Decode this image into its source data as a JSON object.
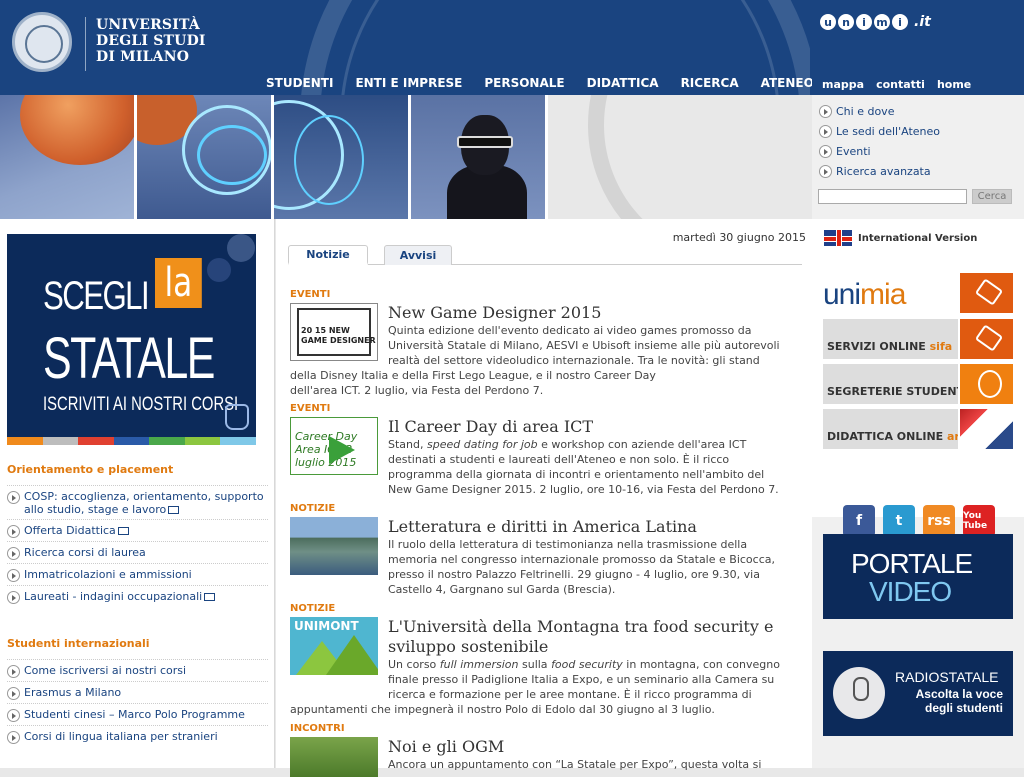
{
  "header": {
    "logo_lines": [
      "UNIVERSITÀ",
      "DEGLI STUDI",
      "DI MILANO"
    ],
    "unimi_letters": [
      "u",
      "n",
      "i",
      "m",
      "i"
    ],
    "unimi_suffix": ".it",
    "nav": [
      "STUDENTI",
      "ENTI E IMPRESE",
      "PERSONALE",
      "DIDATTICA",
      "RICERCA",
      "ATENEO"
    ],
    "util_nav": [
      "mappa",
      "contatti",
      "home"
    ]
  },
  "quick_links": [
    "Chi e dove",
    "Le sedi dell'Ateneo",
    "Eventi",
    "Ricerca avanzata"
  ],
  "search": {
    "value": "",
    "button": "Cerca"
  },
  "promo": {
    "line1": "SCEGLI",
    "la": "la",
    "line2": "STATALE",
    "line3": "ISCRIVITI AI NOSTRI CORSI"
  },
  "color_strip": [
    "#f08a1c",
    "#bdbdbd",
    "#e04030",
    "#2a5aa8",
    "#4aa84a",
    "#8cc63f",
    "#7fc8e8"
  ],
  "left": {
    "section1_title": "Orientamento e placement",
    "section1_items": [
      {
        "label": "COSP: accoglienza, orientamento, supporto allo studio, stage e lavoro",
        "external": true
      },
      {
        "label": "Offerta Didattica",
        "external": true
      },
      {
        "label": "Ricerca corsi di laurea",
        "external": false
      },
      {
        "label": "Immatricolazioni e ammissioni",
        "external": false
      },
      {
        "label": "Laureati - indagini occupazionali",
        "external": true
      }
    ],
    "section2_title": "Studenti internazionali",
    "section2_items": [
      {
        "label": "Come iscriversi ai nostri corsi"
      },
      {
        "label": "Erasmus a Milano"
      },
      {
        "label": "Studenti cinesi – Marco Polo Programme"
      },
      {
        "label": "Corsi di lingua italiana per stranieri"
      }
    ]
  },
  "main": {
    "date": "martedì 30 giugno 2015",
    "tabs": [
      "Notizie",
      "Avvisi"
    ],
    "news": [
      {
        "category": "EVENTI",
        "title": "New Game Designer 2015",
        "thumb_label": "20 15 NEW GAME DESIGNER",
        "description_lines": [
          "Quinta edizione dell'evento dedicato ai video games promosso da",
          "Università Statale di Milano, AESVI e Ubisoft insieme alle più autorevoli",
          "realtà del settore videoludico internazionale. Tra le novità: gli stand",
          "della Disney Italia e della First Lego League, e il nostro Career Day",
          "dell'area ICT. 2 luglio, via Festa del Perdono 7."
        ]
      },
      {
        "category": "EVENTI",
        "title": "Il Career Day di area ICT",
        "thumb_label": "Career Day Area ICT 2 luglio 2015",
        "description_html_parts": [
          "Stand, ",
          "speed dating for job",
          " e workshop con aziende dell'area ICT"
        ],
        "description_lines": [
          "destinati a studenti e laureati dell'Ateneo e non solo. È il ricco",
          "programma della giornata di incontri e orientamento nell'ambito del",
          "New Game Designer 2015. 2 luglio, ore 10-16, via Festa del Perdono 7."
        ]
      },
      {
        "category": "NOTIZIE",
        "title": "Letteratura e diritti in America Latina",
        "description_lines": [
          "Il ruolo della letteratura di testimonianza nella trasmissione della",
          "memoria nel congresso internazionale promosso da Statale e Bicocca,",
          "presso il nostro Palazzo Feltrinelli. 29 giugno - 4 luglio, ore 9.30, via",
          "Castello 4, Gargnano sul Garda (Brescia)."
        ]
      },
      {
        "category": "NOTIZIE",
        "title_lines": [
          "L'Università della Montagna tra food security e",
          "sviluppo sostenibile"
        ],
        "thumb_label": "UNIMONT",
        "description_parts": [
          "Un corso ",
          "full immersion",
          " sulla ",
          "food security",
          " in montagna, con convegno"
        ],
        "description_lines": [
          "finale presso il Padiglione Italia a Expo, e un seminario alla Camera su",
          "ricerca e formazione per le aree montane. È il ricco programma di",
          "appuntamenti che impegnerà il nostro Polo di Edolo dal 30 giugno al 3 luglio."
        ]
      },
      {
        "category": "INCONTRI",
        "title": "Noi e gli OGM",
        "description_lines": [
          "Ancora un appuntamento con “La Statale per Expo”, questa volta si"
        ]
      }
    ]
  },
  "right": {
    "intl": "International Version",
    "services": {
      "unimia": [
        "uni",
        "mia"
      ],
      "sifa": [
        "SERVIZI ONLINE ",
        "sifa"
      ],
      "segreterie": "SEGRETERIE STUDENTI",
      "ariel": [
        "DIDATTICA ONLINE ",
        "ariel"
      ]
    },
    "social": [
      "f",
      "t",
      "rss",
      "You Tube"
    ],
    "portale": [
      "PORTALE",
      "VIDEO"
    ],
    "radio": [
      "RADIOSTATALE",
      "Ascolta la voce",
      "degli studenti"
    ]
  }
}
